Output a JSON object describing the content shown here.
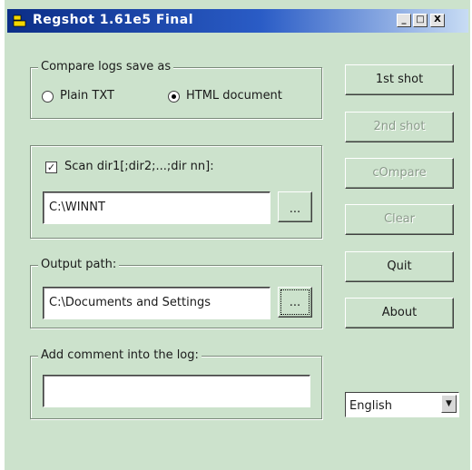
{
  "window": {
    "title": "Regshot 1.61e5 Final",
    "minimize": "_",
    "maximize": "□",
    "close": "X"
  },
  "compare_group": {
    "legend": "Compare logs save as",
    "option_plain": "Plain TXT",
    "option_html": "HTML document",
    "selected": "html"
  },
  "scan_group": {
    "checkbox_label": "Scan dir1[;dir2;...;dir nn]:",
    "checked": true,
    "dir_value": "C:\\WINNT",
    "browse_label": "..."
  },
  "output_group": {
    "legend": "Output path:",
    "path_value": "C:\\Documents and Settings",
    "browse_label": "..."
  },
  "comment_group": {
    "legend": "Add comment into the log:",
    "comment_value": ""
  },
  "buttons": {
    "first_shot": "1st shot",
    "second_shot": "2nd shot",
    "compare": "cOmpare",
    "clear": "Clear",
    "quit": "Quit",
    "about": "About"
  },
  "language": {
    "selected": "English"
  }
}
